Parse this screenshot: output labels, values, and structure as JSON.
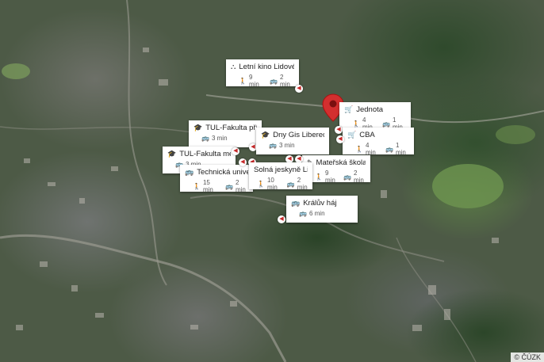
{
  "map": {
    "attribution": "© ČÚZK"
  },
  "pois": [
    {
      "name": "Letní kino Lidové ...",
      "icon": "sitemap-icon",
      "walk": "9 min",
      "bus": "2 min"
    },
    {
      "name": "Jednota",
      "icon": "cart-icon",
      "walk": "4 min",
      "bus": "1 min"
    },
    {
      "name": "TUL-Fakulta přírо...",
      "icon": "graduation-cap-icon",
      "walk": "",
      "bus": "3 min"
    },
    {
      "name": "Dny Gis Liberec",
      "icon": "graduation-cap-icon",
      "walk": "",
      "bus": "3 min"
    },
    {
      "name": "CBA",
      "icon": "cart-icon",
      "walk": "4 min",
      "bus": "1 min"
    },
    {
      "name": "TUL-Fakulta mech...",
      "icon": "graduation-cap-icon",
      "walk": "",
      "bus": "3 min"
    },
    {
      "name": "Mateřská škola Ji...",
      "icon": "school-icon",
      "walk": "9 min",
      "bus": "2 min"
    },
    {
      "name": "Technická univer...",
      "icon": "bus-icon",
      "walk": "15 min",
      "bus": "2 min"
    },
    {
      "name": "Solná jeskyně Lib...",
      "icon": "none",
      "walk": "10 min",
      "bus": "2 min"
    },
    {
      "name": "Králův háj",
      "icon": "bus-icon",
      "walk": "",
      "bus": "6 min"
    }
  ]
}
